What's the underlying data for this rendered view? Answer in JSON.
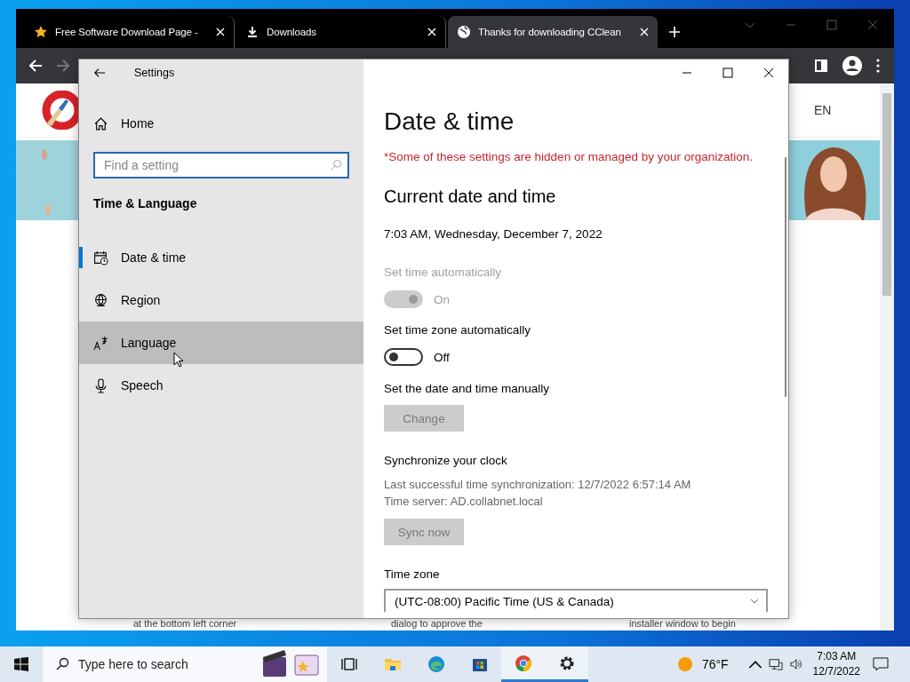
{
  "browser": {
    "tabs": [
      {
        "title": "Free Software Download Page -",
        "kind": "star",
        "selected": false
      },
      {
        "title": "Downloads",
        "kind": "download",
        "selected": false
      },
      {
        "title": "Thanks for downloading CClean",
        "kind": "globe",
        "selected": true
      }
    ],
    "page": {
      "language": "EN",
      "footer_texts": [
        "at the bottom left corner",
        "dialog to approve the",
        "installer window to begin"
      ]
    }
  },
  "settings": {
    "title": "Settings",
    "home": "Home",
    "search": {
      "placeholder": "Find a setting"
    },
    "section": "Time & Language",
    "nav": [
      {
        "label": "Date & time",
        "kind": "calendar",
        "selected": true,
        "hovered": false
      },
      {
        "label": "Region",
        "kind": "globe",
        "selected": false,
        "hovered": false
      },
      {
        "label": "Language",
        "kind": "language",
        "selected": false,
        "hovered": true
      },
      {
        "label": "Speech",
        "kind": "microphone",
        "selected": false,
        "hovered": false
      }
    ],
    "heading": "Date & time",
    "notice": "*Some of these settings are hidden or managed by your organization.",
    "subheading": "Current date and time",
    "current_time": "7:03 AM, Wednesday, December 7, 2022",
    "toggles": [
      {
        "label": "Set time automatically",
        "on": true,
        "disabled": true,
        "state_text": "On"
      },
      {
        "label": "Set time zone automatically",
        "on": false,
        "disabled": false,
        "state_text": "Off"
      }
    ],
    "manual": {
      "label": "Set the date and time manually",
      "button": {
        "label": "Change",
        "disabled": true
      }
    },
    "sync": {
      "heading": "Synchronize your clock",
      "lines": [
        "Last successful time synchronization: 12/7/2022 6:57:14 AM",
        "Time server: AD.collabnet.local"
      ],
      "button": {
        "label": "Sync now",
        "disabled": true
      }
    },
    "time_zone": {
      "label": "Time zone",
      "value": "(UTC-08:00) Pacific Time (US & Canada)"
    }
  },
  "taskbar": {
    "search": {
      "placeholder": "Type here to search"
    },
    "apps": [
      {
        "kind": "task-view",
        "active": false
      },
      {
        "kind": "folder",
        "active": false
      },
      {
        "kind": "edge",
        "active": false
      },
      {
        "kind": "store",
        "active": false
      },
      {
        "kind": "chrome",
        "active": true
      },
      {
        "kind": "gear",
        "active": true
      }
    ],
    "weather": "76°F",
    "time": "7:03 AM",
    "date": "12/7/2022"
  }
}
